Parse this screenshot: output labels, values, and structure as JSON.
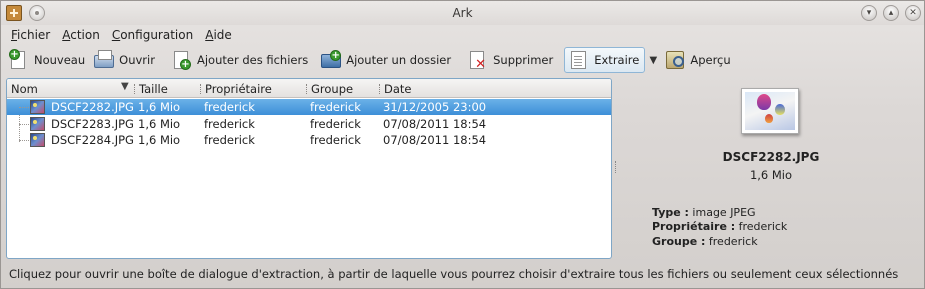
{
  "window": {
    "title": "Ark"
  },
  "menu": {
    "items": [
      {
        "first": "F",
        "rest": "ichier"
      },
      {
        "first": "A",
        "rest": "ction"
      },
      {
        "first": "C",
        "rest": "onfiguration"
      },
      {
        "first": "A",
        "rest": "ide"
      }
    ]
  },
  "toolbar": {
    "new_label": "Nouveau",
    "open_label": "Ouvrir",
    "add_files_label": "Ajouter des fichiers",
    "add_folder_label": "Ajouter un dossier",
    "delete_label": "Supprimer",
    "extract_label": "Extraire",
    "preview_label": "Aperçu"
  },
  "table": {
    "columns": [
      "Nom",
      "Taille",
      "Propriétaire",
      "Groupe",
      "Date"
    ],
    "rows": [
      {
        "name": "DSCF2282.JPG",
        "size": "1,6 Mio",
        "owner": "frederick",
        "group": "frederick",
        "date": "31/12/2005 23:00",
        "selected": true
      },
      {
        "name": "DSCF2283.JPG",
        "size": "1,6 Mio",
        "owner": "frederick",
        "group": "frederick",
        "date": "07/08/2011 18:54",
        "selected": false
      },
      {
        "name": "DSCF2284.JPG",
        "size": "1,6 Mio",
        "owner": "frederick",
        "group": "frederick",
        "date": "07/08/2011 18:54",
        "selected": false
      }
    ]
  },
  "preview": {
    "filename": "DSCF2282.JPG",
    "size": "1,6 Mio",
    "type_label": "Type :",
    "type_value": " image JPEG",
    "owner_label": "Propriétaire :",
    "owner_value": " frederick",
    "group_label": "Groupe :",
    "group_value": " frederick"
  },
  "status": {
    "text": "Cliquez pour ouvrir une boîte de dialogue d'extraction, à partir de laquelle vous pourrez choisir d'extraire tous les fichiers ou seulement ceux sélectionnés"
  },
  "colors": {
    "selection": "#3d8fd8",
    "focus_border": "#7fa6c6"
  }
}
